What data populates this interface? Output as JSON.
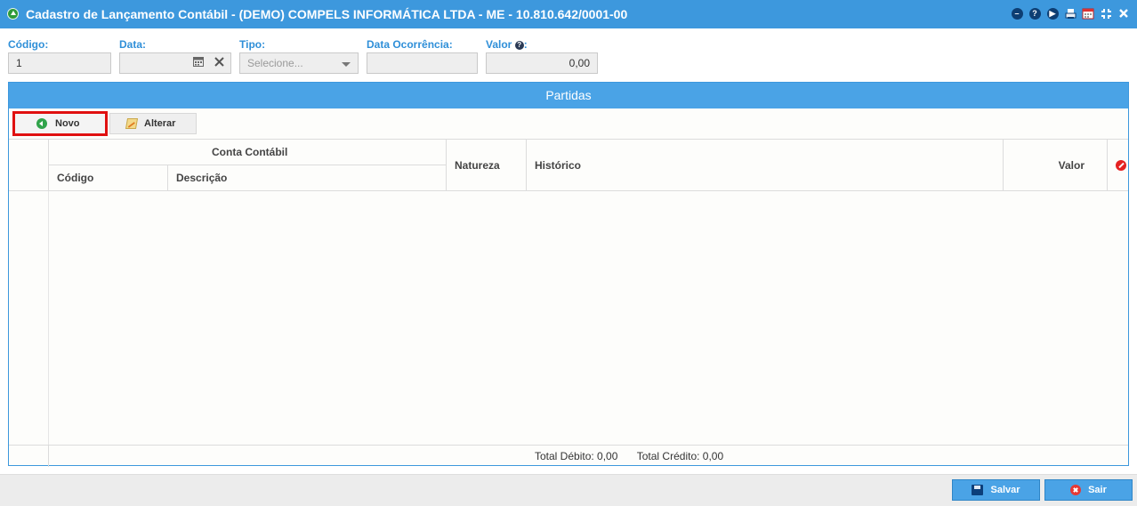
{
  "window": {
    "title": "Cadastro de Lançamento Contábil - (DEMO) COMPELS INFORMÁTICA LTDA - ME - 10.810.642/0001-00",
    "controls": [
      "minimize-icon",
      "help-icon",
      "play-icon",
      "print-icon",
      "calendar-icon",
      "maximize-icon",
      "close-icon"
    ]
  },
  "form": {
    "codigo": {
      "label": "Código:",
      "value": "1"
    },
    "data": {
      "label": "Data:",
      "value": ""
    },
    "tipo": {
      "label": "Tipo:",
      "placeholder": "Selecione..."
    },
    "data_ocorrencia": {
      "label": "Data Ocorrência:",
      "value": ""
    },
    "valor": {
      "label": "Valor",
      "value": "0,00"
    }
  },
  "partidas": {
    "title": "Partidas",
    "toolbar": {
      "novo": "Novo",
      "alterar": "Alterar"
    },
    "columns": {
      "conta_contabil": "Conta Contábil",
      "codigo": "Código",
      "descricao": "Descrição",
      "natureza": "Natureza",
      "historico": "Histórico",
      "valor": "Valor"
    },
    "rows": [],
    "totals": {
      "debito": "Total Débito: 0,00",
      "credito": "Total Crédito: 0,00"
    }
  },
  "footer": {
    "salvar": "Salvar",
    "sair": "Sair"
  },
  "colors": {
    "accent": "#3d98dd",
    "header": "#4aa3e6",
    "highlight": "#e01010"
  }
}
